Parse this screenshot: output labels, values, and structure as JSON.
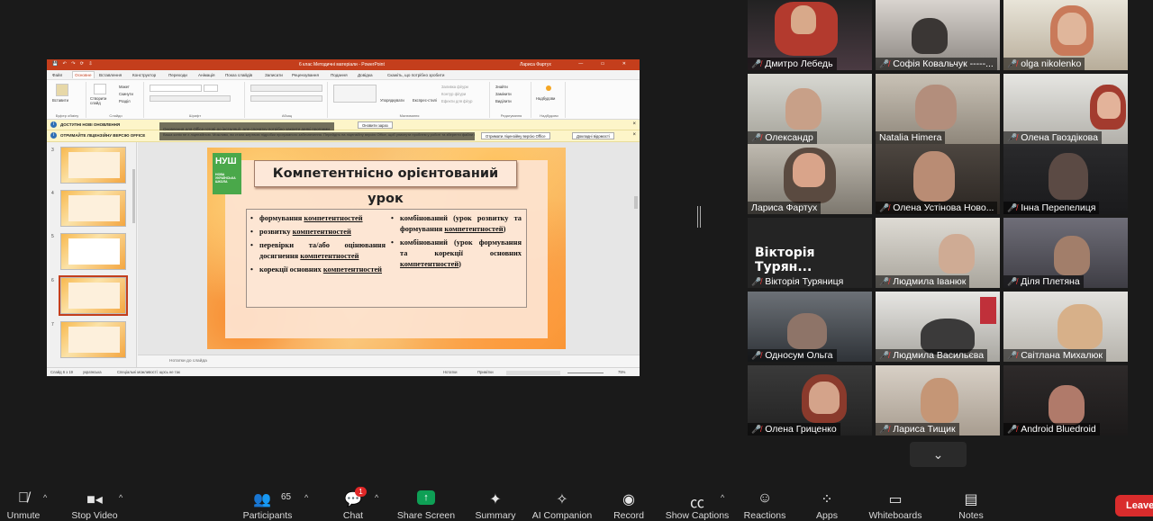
{
  "powerpoint": {
    "title_bar": {
      "document": "6 клас Методичні матеріали - PowerPoint",
      "user": "Лариса Фартух",
      "quick_access": "💾 ↶ ↷ ⟳ ⇩",
      "window_controls": "— ▭ ✕"
    },
    "tabs": [
      "Файл",
      "Основне",
      "Вставлення",
      "Конструктор",
      "Переходи",
      "Анімація",
      "Показ слайдів",
      "Записати",
      "Рецензування",
      "Подання",
      "Довідка",
      "Скажіть, що потрібно зробити"
    ],
    "ribbon_groups": [
      "Буфер обміну",
      "Слайди",
      "Шрифт",
      "Абзац",
      "Малювання",
      "Редагування",
      "Надбудови"
    ],
    "ribbon_buttons": {
      "paste": "Вставити",
      "new_slide": "Створити слайд",
      "layout": "Макет",
      "reset": "Скинути",
      "section": "Розділ",
      "arrange": "Упорядкувати",
      "quick_styles": "Експрес-стилі",
      "shape_fill": "Заливка фігури",
      "shape_outline": "Контур фігури",
      "shape_effects": "Ефекти для фігур",
      "find": "Знайти",
      "replace": "Замінити",
      "select": "Виділити",
      "addins": "Надбудови"
    },
    "notices": [
      {
        "title": "ДОСТУПНІ НОВІ ОНОВЛЕННЯ",
        "message": "Оновлення для Office готові до інсталяції, але спочатку потрібно закрити деякі програми.",
        "buttons": [
          "Оновити зараз"
        ]
      },
      {
        "title": "ОТРИМАЙТЕ ЛІЦЕНЗІЙНУ ВЕРСІЮ OFFICE",
        "message": "Ваша копія не є ліцензійною. Можливо, ви стали жертвою підробки програмного забезпечення. Перейдіть на ліцензійну версію Office, щоб уникнути проблем у роботі та зберегти файли в безпеці.",
        "buttons": [
          "Отримати ліцензійну версію Office",
          "Докладні відомості"
        ]
      }
    ],
    "thumbnails": [
      {
        "num": "3",
        "selected": false
      },
      {
        "num": "4",
        "selected": false
      },
      {
        "num": "5",
        "selected": false
      },
      {
        "num": "6",
        "selected": true
      },
      {
        "num": "7",
        "selected": false
      }
    ],
    "notes_placeholder": "Нотатки до слайда",
    "status": {
      "slide": "Слайд 6 з 19",
      "language": "українська",
      "accessibility": "Спеціальні можливості: щось не так",
      "notes": "Нотатки",
      "comments": "Примітки",
      "zoom": "75%"
    },
    "slide": {
      "logo_text": "НУШ",
      "logo_subtext": "НОВА УКРАЇНСЬКА ШКОЛА",
      "title": "Компетентнісно орієнтований урок",
      "left_items": [
        {
          "before": "формування ",
          "underlined": "компетентностей",
          "after": ""
        },
        {
          "before": "розвитку ",
          "underlined": "компетентностей",
          "after": ""
        },
        {
          "before": "перевірки та/або оцінювання досягнення ",
          "underlined": "компетентностей",
          "after": ""
        },
        {
          "before": "корекції основних ",
          "underlined": "компетентностей",
          "after": ""
        }
      ],
      "right_items": [
        {
          "before": "комбінований (урок розвитку та формування ",
          "underlined": "компетентностей",
          "after": ")"
        },
        {
          "before": "комбінований (урок формування та корекції основних ",
          "underlined": "компетентностей",
          "after": ")"
        }
      ]
    }
  },
  "participants": [
    {
      "name": "Дмитро Лебедь",
      "muted": true
    },
    {
      "name": "Софія Ковальчук -----...",
      "muted": true
    },
    {
      "name": "olga nikolenko",
      "muted": true
    },
    {
      "name": "Олександр",
      "muted": true
    },
    {
      "name": "Natalia Himera",
      "muted": false
    },
    {
      "name": "Олена Гвоздікова",
      "muted": true
    },
    {
      "name": "Лариса Фартух",
      "muted": false,
      "speaking": true
    },
    {
      "name": "Олена Устінова Ново...",
      "muted": true
    },
    {
      "name": "Інна Перепелиця",
      "muted": true
    },
    {
      "name": "Вікторія Туряниця",
      "muted": true,
      "video_off_label": "Вікторія Турян..."
    },
    {
      "name": "Людмила Іванюк",
      "muted": true
    },
    {
      "name": "Діля Плетяна",
      "muted": true
    },
    {
      "name": "Односум Ольга",
      "muted": true
    },
    {
      "name": "Людмила Васильєва",
      "muted": true
    },
    {
      "name": "Світлана Михалюк",
      "muted": true
    },
    {
      "name": "Олена Гриценко",
      "muted": true
    },
    {
      "name": "Лариса Тищик",
      "muted": true
    },
    {
      "name": "Android Bluedroid",
      "muted": true
    }
  ],
  "toolbar": {
    "unmute": "Unmute",
    "stop_video": "Stop Video",
    "participants": "Participants",
    "participants_count": "65",
    "chat": "Chat",
    "chat_badge": "1",
    "share_screen": "Share Screen",
    "summary": "Summary",
    "ai_companion": "AI Companion",
    "record": "Record",
    "show_captions": "Show Captions",
    "reactions": "Reactions",
    "apps": "Apps",
    "whiteboards": "Whiteboards",
    "notes": "Notes",
    "leave": "Leave",
    "more_chevron": "⌄"
  },
  "colors": {
    "powerpoint_accent": "#c43e1c",
    "share_green": "#0e9f55",
    "leave_red": "#d92c2c",
    "muted_red": "#ff3b3b",
    "speaker_outline": "#c5c94a"
  }
}
